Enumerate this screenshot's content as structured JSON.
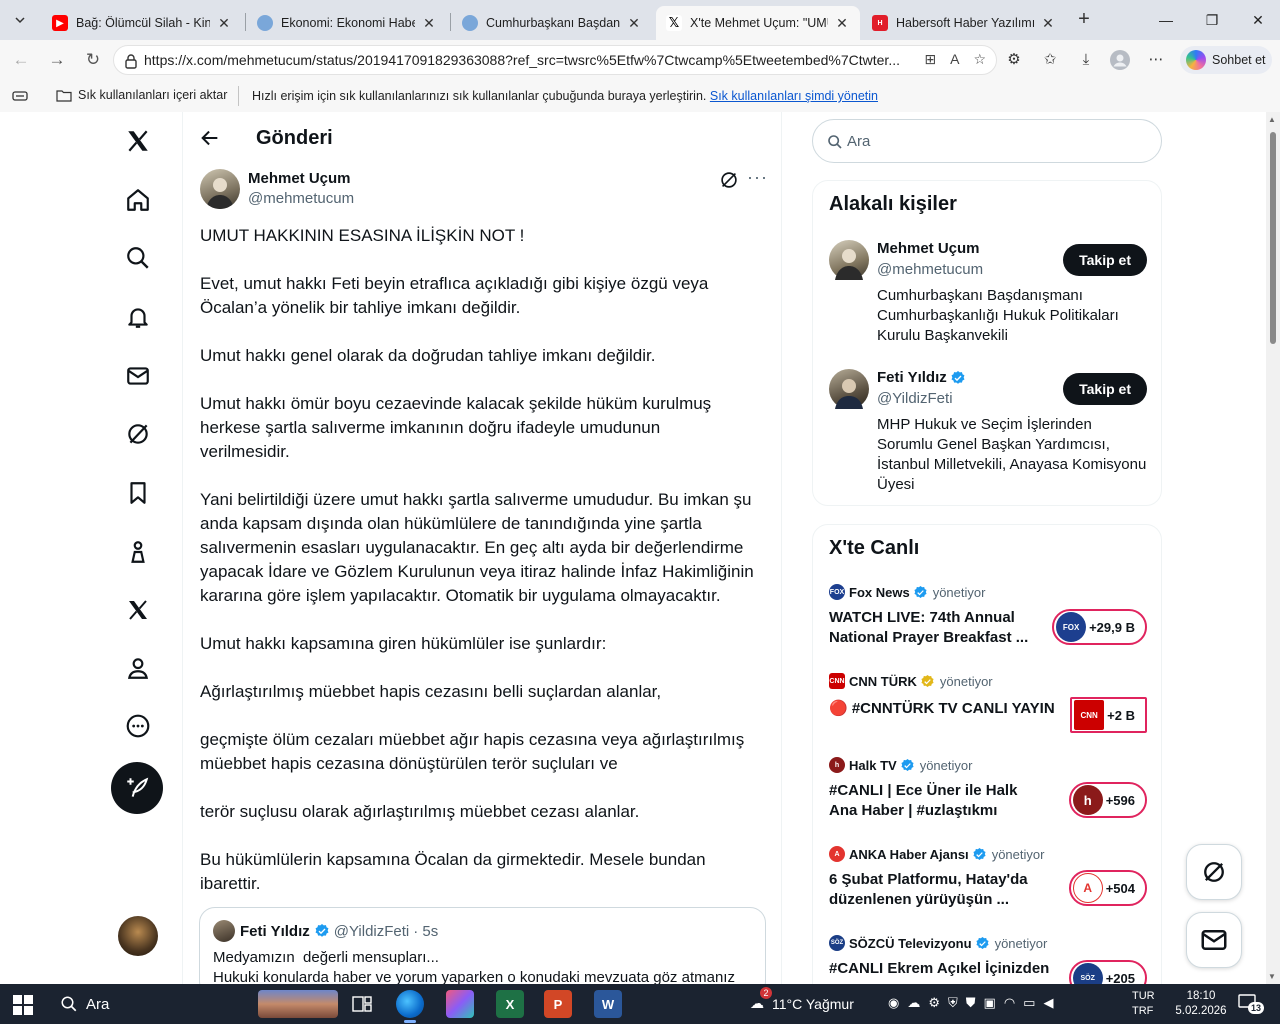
{
  "browser": {
    "tabs": [
      {
        "title": "Bağ: Ölümcül Silah - Kin | Tu",
        "favicon": "youtube-icon",
        "color": "#ff0000",
        "active": false
      },
      {
        "title": "Ekonomi: Ekonomi Haberler",
        "favicon": "globe-icon",
        "color": "#7aa7d9",
        "active": false
      },
      {
        "title": "Cumhurbaşkanı Başdanışma",
        "favicon": "globe-icon",
        "color": "#7aa7d9",
        "active": false
      },
      {
        "title": "X'te Mehmet Uçum: \"UMUT",
        "favicon": "x-logo-icon",
        "color": "#000000",
        "active": true
      },
      {
        "title": "Habersoft Haber Yazılımı",
        "favicon": "habersoft-icon",
        "color": "#e11d2a",
        "active": false
      }
    ],
    "url": "https://x.com/mehmetucum/status/2019417091829363088?ref_src=twsrc%5Etfw%7Ctwcamp%5Etweetembed%7Ctwter...",
    "copilot_label": "Sohbet et",
    "favorites_bar": {
      "import_label": "Sık kullanılanları içeri aktar",
      "hint": "Hızlı erişim için sık kullanılanlarınızı sık kullanılanlar çubuğunda buraya yerleştirin.",
      "hint_link": "Sık kullanılanları şimdi yönetin"
    }
  },
  "post": {
    "header_title": "Gönderi",
    "author_name": "Mehmet Uçum",
    "author_handle": "@mehmetucum",
    "paragraphs": [
      "UMUT HAKKININ ESASINA İLİŞKİN NOT !",
      "Evet, umut hakkı Feti beyin etraflıca açıkladığı gibi kişiye özgü veya\nÖcalan’a yönelik bir tahliye imkanı değildir.",
      "Umut hakkı genel olarak da doğrudan tahliye imkanı değildir.",
      "Umut hakkı ömür boyu cezaevinde kalacak şekilde hüküm kurulmuş\nherkese şartla salıverme imkanının doğru ifadeyle umudunun\nverilmesidir.",
      "Yani belirtildiği üzere umut hakkı şartla salıverme umududur. Bu imkan şu\nanda kapsam dışında olan hükümlülere de tanındığında yine şartla\nsalıvermenin esasları uygulanacaktır. En geç altı ayda bir değerlendirme\nyapacak İdare ve Gözlem Kurulunun veya itiraz halinde İnfaz Hakimliğinin\nkararına göre işlem yapılacaktır. Otomatik bir uygulama olmayacaktır.",
      "Umut hakkı kapsamına giren hükümlüler ise şunlardır:",
      "Ağırlaştırılmış müebbet hapis cezasını belli suçlardan alanlar,",
      "geçmişte ölüm cezaları müebbet ağır hapis cezasına veya ağırlaştırılmış\nmüebbet hapis cezasına dönüştürülen terör suçluları ve",
      "terör suçlusu olarak ağırlaştırılmış müebbet cezası alanlar.",
      "Bu hükümlülerin kapsamına Öcalan da girmektedir. Mesele bundan\nibarettir."
    ],
    "quote": {
      "author_name": "Feti Yıldız",
      "author_handle": "@YildizFeti",
      "time": "· 5s",
      "line1": "Medyamızın  değerli mensupları...",
      "line2": "Hukuki konularda haber ve yorum yaparken o konudaki mevzuata göz atmanız"
    }
  },
  "sidebar": {
    "search_placeholder": "Ara",
    "related_title": "Alakalı kişiler",
    "people": [
      {
        "name": "Mehmet Uçum",
        "handle": "@mehmetucum",
        "verified": false,
        "bio": "Cumhurbaşkanı Başdanışmanı Cumhurbaşkanlığı Hukuk Politikaları Kurulu Başkanvekili",
        "follow_label": "Takip et"
      },
      {
        "name": "Feti Yıldız",
        "handle": "@YildizFeti",
        "verified": true,
        "bio": "MHP Hukuk ve Seçim İşlerinden Sorumlu Genel Başkan Yardımcısı, İstanbul Milletvekili, Anayasa Komisyonu Üyesi",
        "follow_label": "Takip et"
      }
    ],
    "live_title": "X'te Canlı",
    "live": [
      {
        "host": "Fox News",
        "role": "yönetiyor",
        "title": "WATCH LIVE: 74th Annual National Prayer Breakfast ...",
        "count": "+29,9 B",
        "verified": "blue",
        "color": "#1d3f8f",
        "logo": "FOX"
      },
      {
        "host": "CNN TÜRK",
        "role": "yönetiyor",
        "title": "🔴 #CNNTÜRK TV CANLI YAYIN",
        "count": "+2 B",
        "verified": "gold",
        "color": "#cc0000",
        "logo": "CNN"
      },
      {
        "host": "Halk TV",
        "role": "yönetiyor",
        "title": "#CANLI | Ece Üner ile Halk Ana Haber | #uzlaştıkmı",
        "count": "+596",
        "verified": "blue",
        "color": "#8b1a1a",
        "logo": "h"
      },
      {
        "host": "ANKA Haber Ajansı",
        "role": "yönetiyor",
        "title": "6 Şubat Platformu, Hatay'da düzenlenen yürüyüşün ...",
        "count": "+504",
        "verified": "blue",
        "color": "#e3342f",
        "logo": "A"
      },
      {
        "host": "SÖZCÜ Televizyonu",
        "role": "yönetiyor",
        "title": "#CANLI Ekrem Açıkel İçinizden",
        "count": "+205",
        "verified": "blue",
        "color": "#1b3e86",
        "logo": "SÖZ"
      }
    ]
  },
  "taskbar": {
    "search_label": "Ara",
    "weather": "11°C  Yağmur",
    "weather_badge": "2",
    "lang_line1": "TUR",
    "lang_line2": "TRF",
    "time": "18:10",
    "date": "5.02.2026",
    "notif_count": "13"
  }
}
